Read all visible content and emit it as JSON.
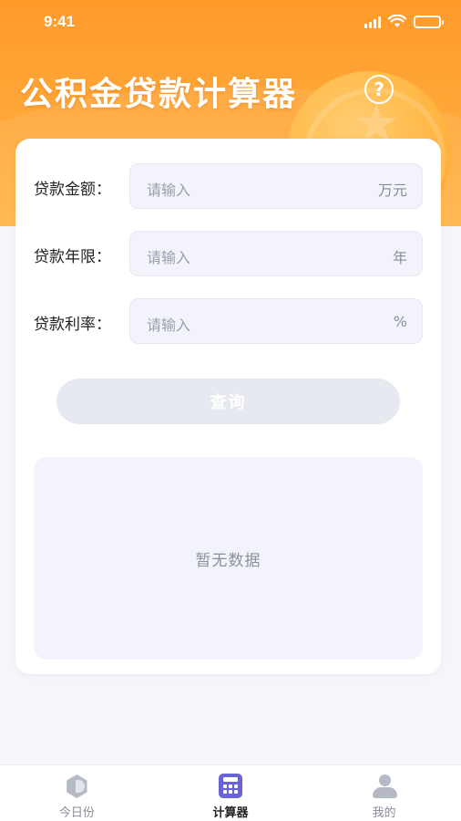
{
  "status_bar": {
    "time": "9:41"
  },
  "header": {
    "title": "公积金贷款计算器",
    "help_icon": "?"
  },
  "form": {
    "fields": [
      {
        "label": "贷款金额：",
        "placeholder": "请输入",
        "unit": "万元"
      },
      {
        "label": "贷款年限：",
        "placeholder": "请输入",
        "unit": "年"
      },
      {
        "label": "贷款利率：",
        "placeholder": "请输入",
        "unit": "%"
      }
    ],
    "query_button": "查询"
  },
  "result": {
    "empty_text": "暂无数据"
  },
  "tab_bar": {
    "items": [
      {
        "label": "今日份",
        "icon": "today-icon",
        "active": false
      },
      {
        "label": "计算器",
        "icon": "calculator-icon",
        "active": true
      },
      {
        "label": "我的",
        "icon": "user-icon",
        "active": false
      }
    ]
  },
  "colors": {
    "header_orange": "#ffa83a",
    "accent_purple": "#6a63d8",
    "background": "#f4f6fc"
  }
}
